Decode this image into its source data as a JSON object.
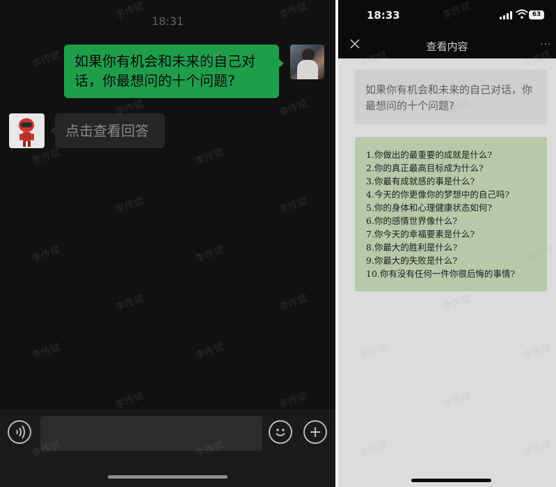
{
  "chat": {
    "time": "18:31",
    "outgoing_message": "如果你有机会和未来的自己对话，你最想问的十个问题?",
    "incoming_message": "点击查看回答"
  },
  "detail": {
    "status_time": "18:33",
    "battery": "63",
    "title": "查看内容",
    "more": "···",
    "question": "如果你有机会和未来的自己对话，你最想问的十个问题?",
    "answers": [
      "1.你做出的最重要的成就是什么?",
      "2.你的真正最高目标成为什么?",
      "3.你最有成就感的事是什么?",
      "4.今天的你更像你的梦想中的自己吗?",
      "5.你的身体和心理健康状态如何?",
      "6.你的感情世界像什么?",
      "7.你今天的幸福要素是什么?",
      "8.你最大的胜利是什么?",
      "9.你最大的失败是什么?",
      "10.你有没有任何一件你很后悔的事情?"
    ]
  },
  "watermark": "李传斌",
  "icons": {
    "voice": "voice-icon",
    "emoji": "emoji-icon",
    "plus": "plus-icon",
    "close": "close-icon",
    "wifi": "wifi-icon",
    "signal": "signal-icon",
    "battery": "battery-icon"
  },
  "colors": {
    "outgoing_bubble": "#1f9e4a",
    "answer_card": "#b8c9a9"
  }
}
